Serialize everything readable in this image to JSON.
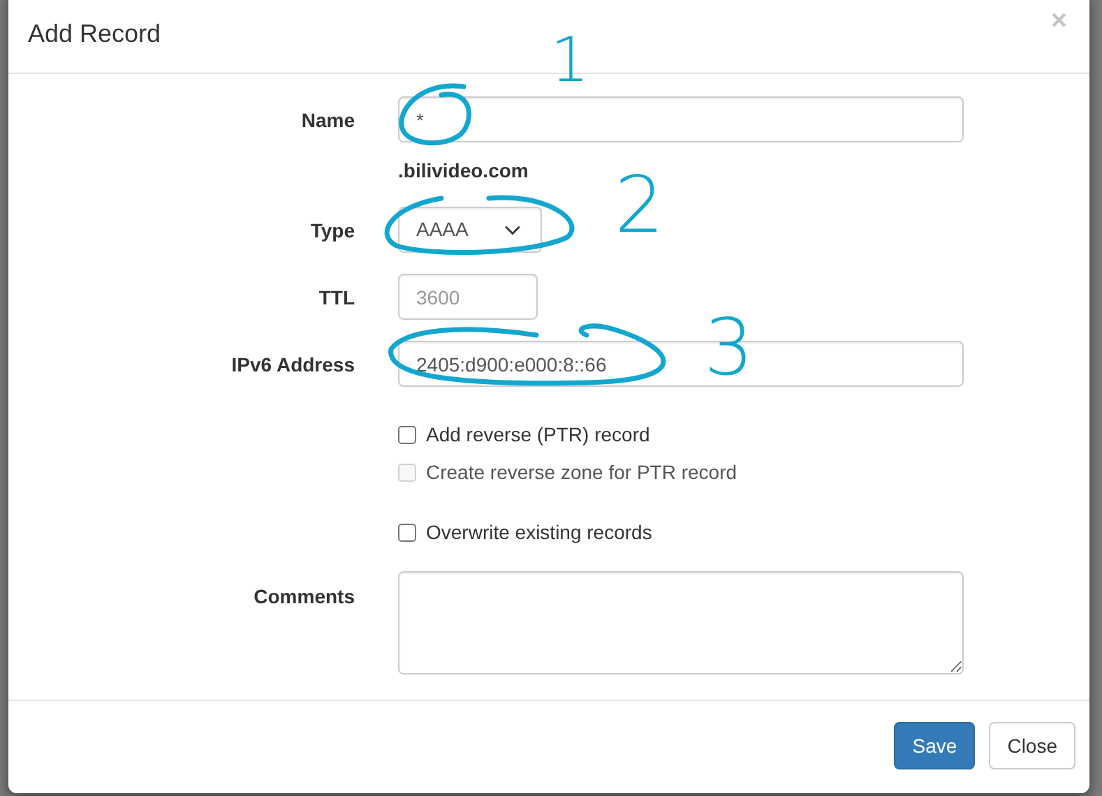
{
  "dialog": {
    "title": "Add Record",
    "close_symbol": "×"
  },
  "fields": [
    {
      "kind": "text",
      "label": "Name",
      "value": "*",
      "note": ".bilivideo.com"
    },
    {
      "kind": "select",
      "label": "Type",
      "value": "AAAA"
    },
    {
      "kind": "short",
      "label": "TTL",
      "placeholder": "3600"
    },
    {
      "kind": "text",
      "label": "IPv6 Address",
      "value": "2405:d900:e000:8::66"
    }
  ],
  "checkboxes": [
    {
      "label": "Add reverse (PTR) record",
      "checked": false,
      "disabled": false
    },
    {
      "label": "Create reverse zone for PTR record",
      "checked": false,
      "disabled": true
    },
    {
      "label": "Overwrite existing records",
      "checked": false,
      "disabled": false
    }
  ],
  "comments": {
    "label": "Comments"
  },
  "buttons": [
    {
      "label": "Save",
      "kind": "primary"
    },
    {
      "label": "Close",
      "kind": "secondary"
    }
  ],
  "annotations": [
    {
      "label": "1"
    },
    {
      "label": "2"
    },
    {
      "label": "3"
    }
  ]
}
